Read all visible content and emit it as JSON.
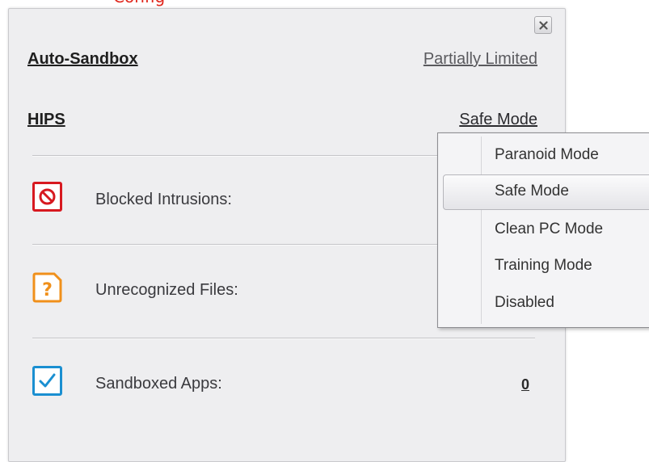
{
  "header": {
    "red_text": "Config"
  },
  "panel": {
    "close_label": "×",
    "auto_sandbox": {
      "label": "Auto-Sandbox",
      "value": "Partially Limited"
    },
    "hips": {
      "label": "HIPS",
      "value": "Safe Mode"
    },
    "stats": [
      {
        "label": "Blocked Intrusions:",
        "icon": "blocked-icon",
        "count": ""
      },
      {
        "label": "Unrecognized Files:",
        "icon": "question-icon",
        "count": ""
      },
      {
        "label": "Sandboxed Apps:",
        "icon": "checkbox-icon",
        "count": "0"
      }
    ]
  },
  "dropdown": {
    "options": [
      "Paranoid Mode",
      "Safe Mode",
      "Clean PC Mode",
      "Training Mode",
      "Disabled"
    ],
    "selected": "Safe Mode"
  },
  "colors": {
    "blocked": "#d71920",
    "unrecognized": "#f0901b",
    "sandboxed": "#1a8fd1"
  }
}
